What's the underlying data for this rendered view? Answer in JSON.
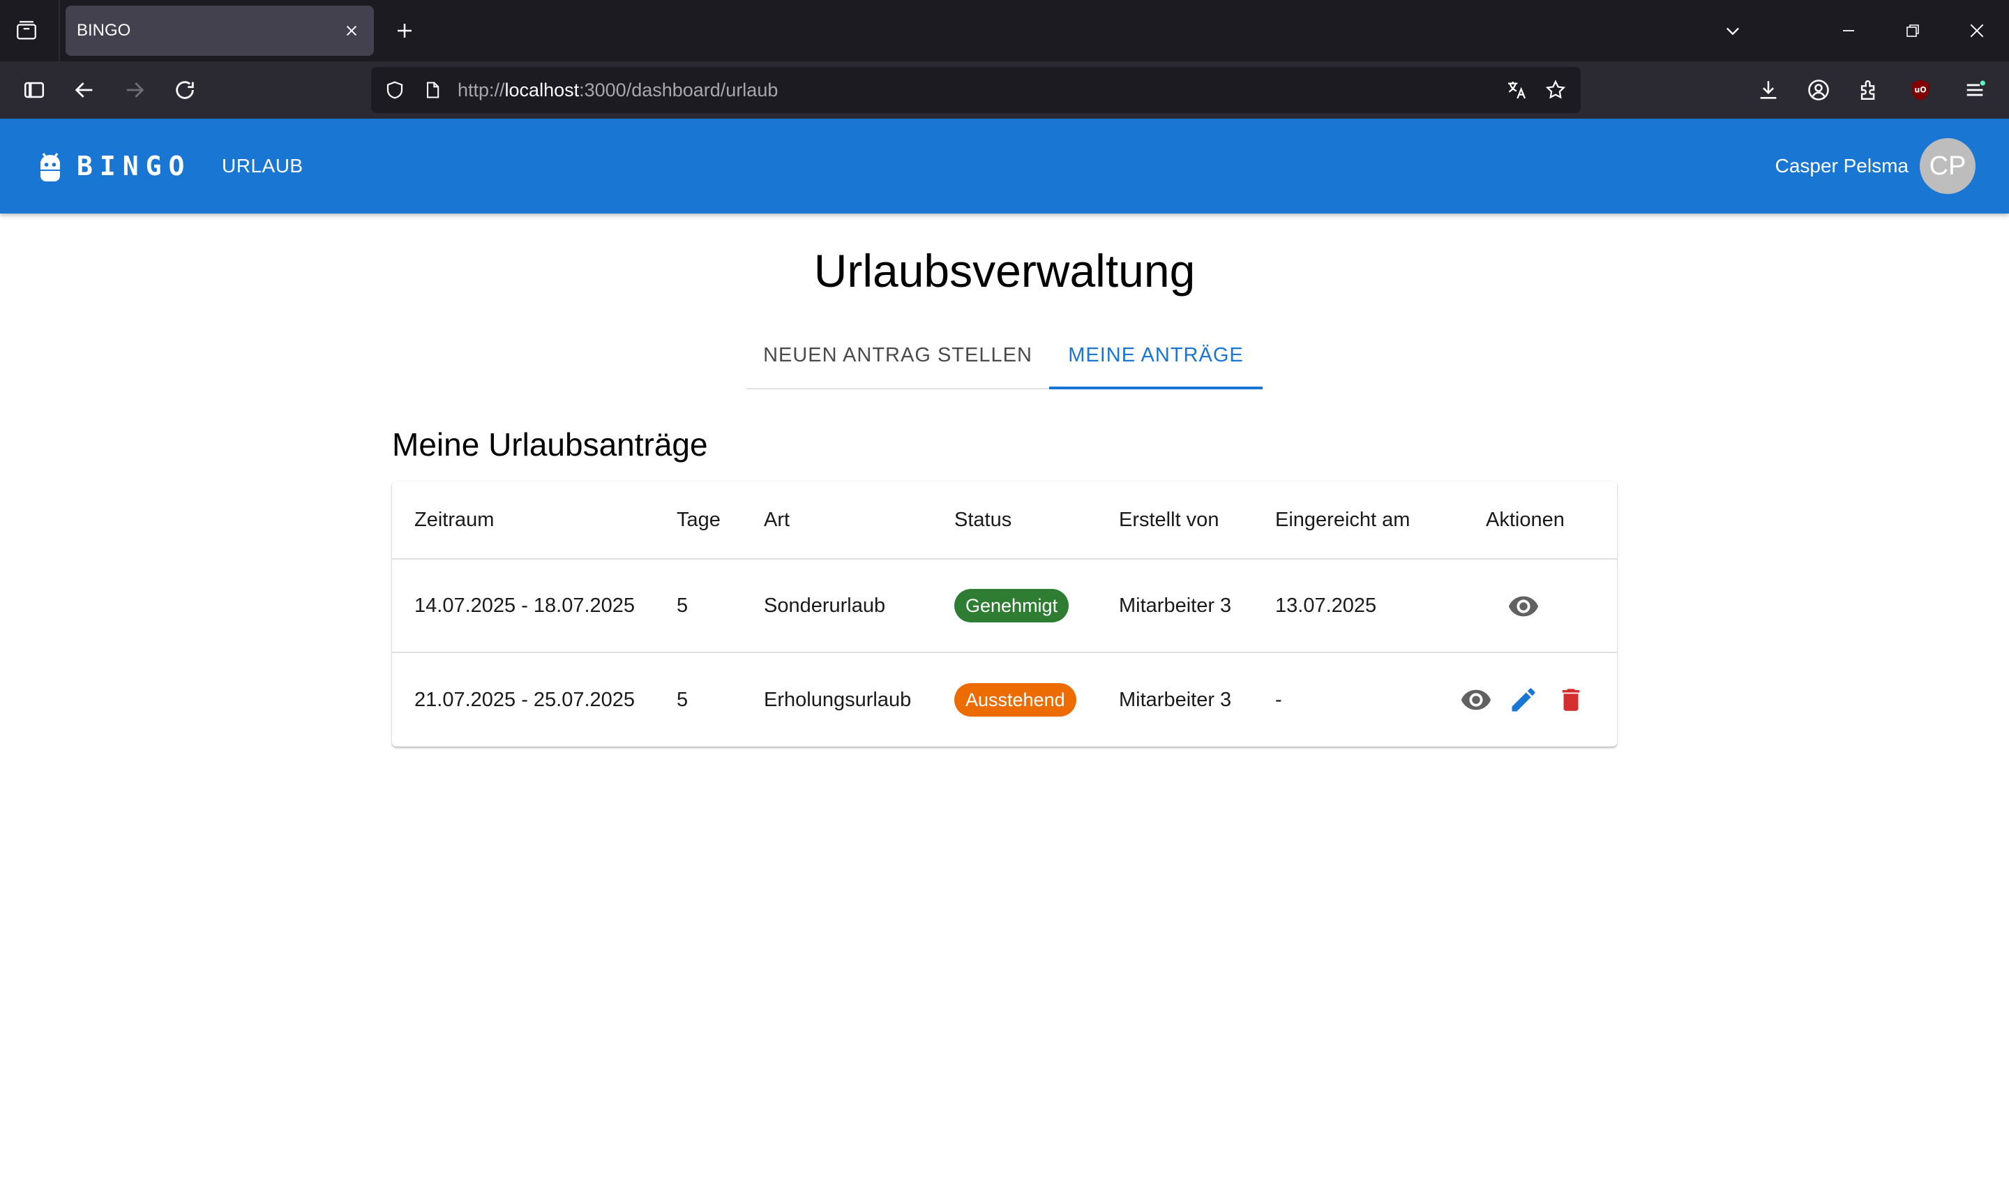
{
  "browser": {
    "tab_title": "BINGO",
    "url_prefix": "http://",
    "url_host": "localhost",
    "url_rest": ":3000/dashboard/urlaub"
  },
  "appbar": {
    "logo_text": "BINGO",
    "nav_link": "URLAUB",
    "user_name": "Casper Pelsma",
    "avatar_initials": "CP",
    "color": "#1976d2"
  },
  "page": {
    "title": "Urlaubsverwaltung",
    "tabs": [
      {
        "label": "NEUEN ANTRAG STELLEN",
        "active": false
      },
      {
        "label": "MEINE ANTRÄGE",
        "active": true
      }
    ],
    "section_title": "Meine Urlaubsanträge"
  },
  "table": {
    "columns": [
      "Zeitraum",
      "Tage",
      "Art",
      "Status",
      "Erstellt von",
      "Eingereicht am",
      "Aktionen"
    ],
    "rows": [
      {
        "zeitraum": "14.07.2025 - 18.07.2025",
        "tage": "5",
        "art": "Sonderurlaub",
        "status": "Genehmigt",
        "status_color": "#2e7d32",
        "erstellt_von": "Mitarbeiter 3",
        "eingereicht_am": "13.07.2025",
        "actions": [
          "view-icon"
        ]
      },
      {
        "zeitraum": "21.07.2025 - 25.07.2025",
        "tage": "5",
        "art": "Erholungsurlaub",
        "status": "Ausstehend",
        "status_color": "#ed6c02",
        "erstellt_von": "Mitarbeiter 3",
        "eingereicht_am": "-",
        "actions": [
          "view-icon",
          "edit-icon",
          "delete-icon"
        ]
      }
    ]
  }
}
